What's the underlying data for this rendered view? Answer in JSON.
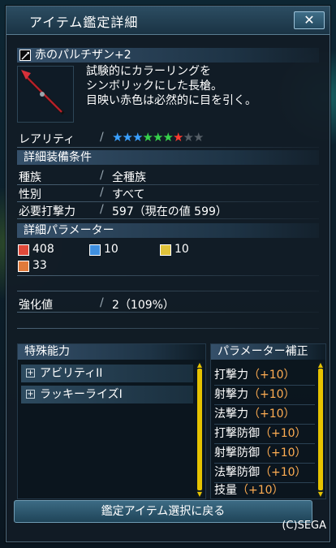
{
  "window": {
    "title": "アイテム鑑定詳細",
    "close_label": "✕"
  },
  "item": {
    "name": "赤のパルチザン+2",
    "description": [
      "試験的にカラーリングを",
      "シンボリックにした長槍。",
      "目映い赤色は必然的に目を引く。"
    ],
    "rarity_label": "レアリティ",
    "rarity_stars": 7,
    "rarity_max": 9,
    "star_colors": [
      "#3aa0ff",
      "#3aa0ff",
      "#3aa0ff",
      "#36d14b",
      "#36d14b",
      "#36d14b",
      "#ff3b2f",
      "#555e66",
      "#555e66"
    ]
  },
  "requirements": {
    "header": "詳細装備条件",
    "rows": [
      {
        "label": "種族",
        "value": "全種族"
      },
      {
        "label": "性別",
        "value": "すべて"
      },
      {
        "label": "必要打撃力",
        "value": "597（現在の値 599）"
      }
    ]
  },
  "parameters": {
    "header": "詳細パラメーター",
    "stats": [
      {
        "icon": "sword-attack-icon",
        "value": "408",
        "color": "#e04a3a"
      },
      {
        "icon": "ranged-attack-icon",
        "value": "10",
        "color": "#3f8fe0"
      },
      {
        "icon": "tech-attack-icon",
        "value": "10",
        "color": "#e0c23a"
      },
      {
        "icon": "dexterity-icon",
        "value": "33",
        "color": "#e07a3a"
      }
    ],
    "enhance_label": "強化値",
    "enhance_value": "2（109%）"
  },
  "special_abilities": {
    "header": "特殊能力",
    "items": [
      "アビリティII",
      "ラッキーライズI"
    ]
  },
  "param_bonus": {
    "header": "パラメーター補正",
    "items": [
      {
        "label": "打撃力",
        "value": "（+10）"
      },
      {
        "label": "射撃力",
        "value": "（+10）"
      },
      {
        "label": "法撃力",
        "value": "（+10）"
      },
      {
        "label": "打撃防御",
        "value": "（+10）"
      },
      {
        "label": "射撃防御",
        "value": "（+10）"
      },
      {
        "label": "法撃防御",
        "value": "（+10）"
      },
      {
        "label": "技量",
        "value": "（+10）"
      }
    ]
  },
  "footer": {
    "return_label": "鑑定アイテム選択に戻る",
    "copyright": "(C)SEGA"
  }
}
